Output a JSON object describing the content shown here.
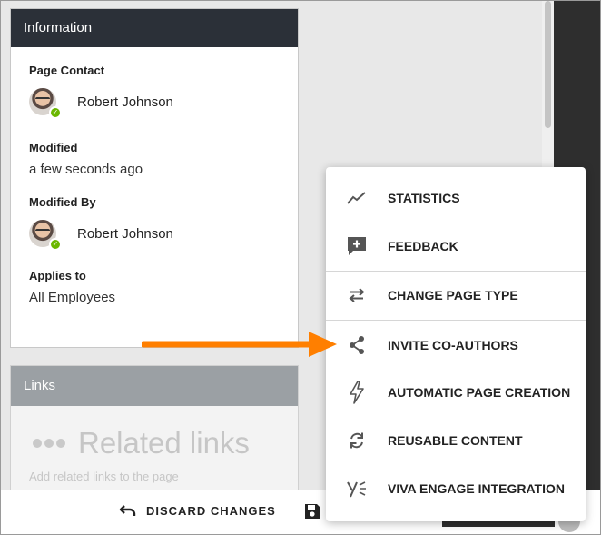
{
  "information": {
    "title": "Information",
    "page_contact_label": "Page Contact",
    "page_contact_name": "Robert Johnson",
    "modified_label": "Modified",
    "modified_value": "a few seconds ago",
    "modified_by_label": "Modified By",
    "modified_by_name": "Robert Johnson",
    "applies_to_label": "Applies to",
    "applies_to_value": "All Employees"
  },
  "links": {
    "title": "Links",
    "related_title": "Related links",
    "related_hint": "Add related links to the page"
  },
  "bottom_bar": {
    "discard_label": "DISCARD CHANGES"
  },
  "menu": {
    "items": [
      {
        "label": "STATISTICS",
        "icon": "trend-line-icon"
      },
      {
        "label": "FEEDBACK",
        "icon": "feedback-plus-icon"
      },
      {
        "label": "CHANGE PAGE TYPE",
        "icon": "swap-arrows-icon"
      },
      {
        "label": "INVITE CO-AUTHORS",
        "icon": "share-icon"
      },
      {
        "label": "AUTOMATIC PAGE CREATION",
        "icon": "lightning-icon"
      },
      {
        "label": "REUSABLE CONTENT",
        "icon": "refresh-icon"
      },
      {
        "label": "VIVA ENGAGE INTEGRATION",
        "icon": "viva-engage-icon"
      }
    ]
  },
  "colors": {
    "header_dark": "#2b3038",
    "header_links": "#9ba0a4",
    "status_green": "#6bb700",
    "annotation_arrow": "#ff7f00"
  }
}
